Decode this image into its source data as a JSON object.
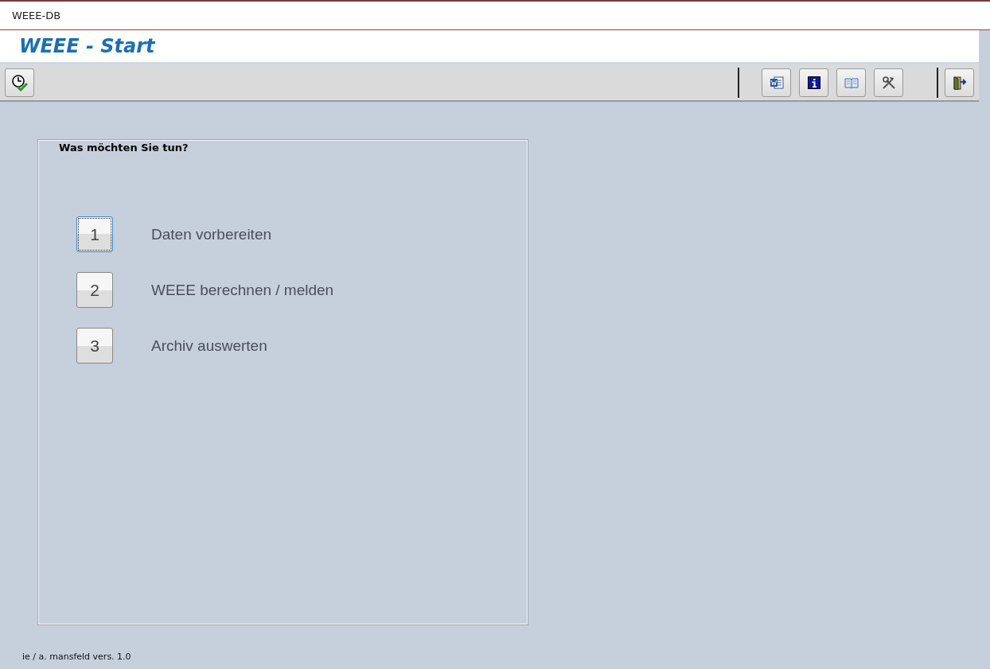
{
  "window": {
    "title": "WEEE-DB"
  },
  "form": {
    "title": "WEEE - Start"
  },
  "panel": {
    "heading": "Was möchten Sie tun?",
    "steps": [
      {
        "number": "1",
        "label": "Daten vorbereiten",
        "focused": true
      },
      {
        "number": "2",
        "label": "WEEE berechnen / melden",
        "focused": false
      },
      {
        "number": "3",
        "label": "Archiv auswerten",
        "focused": false
      }
    ]
  },
  "footer": "ie / a. mansfeld vers. 1.0"
}
